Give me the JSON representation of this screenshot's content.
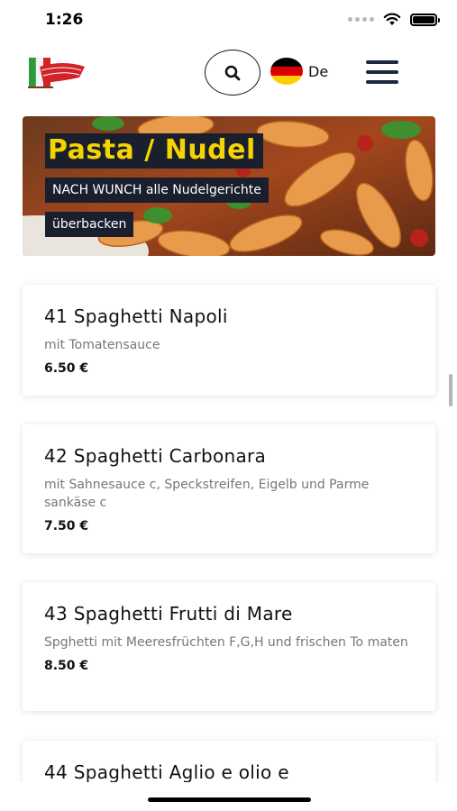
{
  "status": {
    "time": "1:26"
  },
  "header": {
    "logo_icon": "restaurant-logo-italian-flag",
    "search_icon": "search-icon",
    "language_label": "De",
    "flag_colors": [
      "#000000",
      "#dd0000",
      "#ffce00"
    ],
    "menu_icon": "hamburger-menu-icon"
  },
  "category": {
    "title": "Pasta / Nudel",
    "subtitle_line1": "NACH WUNCH alle Nudelgerichte",
    "subtitle_line2": "überbacken"
  },
  "menu_items": [
    {
      "title": "41 Spaghetti Napoli",
      "description": "mit Tomatensauce",
      "price": "6.50 €"
    },
    {
      "title": "42 Spaghetti Carbonara",
      "description": "mit Sahnesauce c, Speckstreifen, Eigelb und Parme sankäse c",
      "price": "7.50 €"
    },
    {
      "title": "43 Spaghetti Frutti di Mare",
      "description": "Spghetti mit Meeresfrüchten F,G,H und frischen To maten",
      "price": "8.50 €"
    },
    {
      "title": "44 Spaghetti Aglio e olio e"
    }
  ],
  "colors": {
    "hero_title_text": "#f5d400",
    "hero_label_bg": "#1a1f2e",
    "menu_icon": "#1d2742"
  }
}
